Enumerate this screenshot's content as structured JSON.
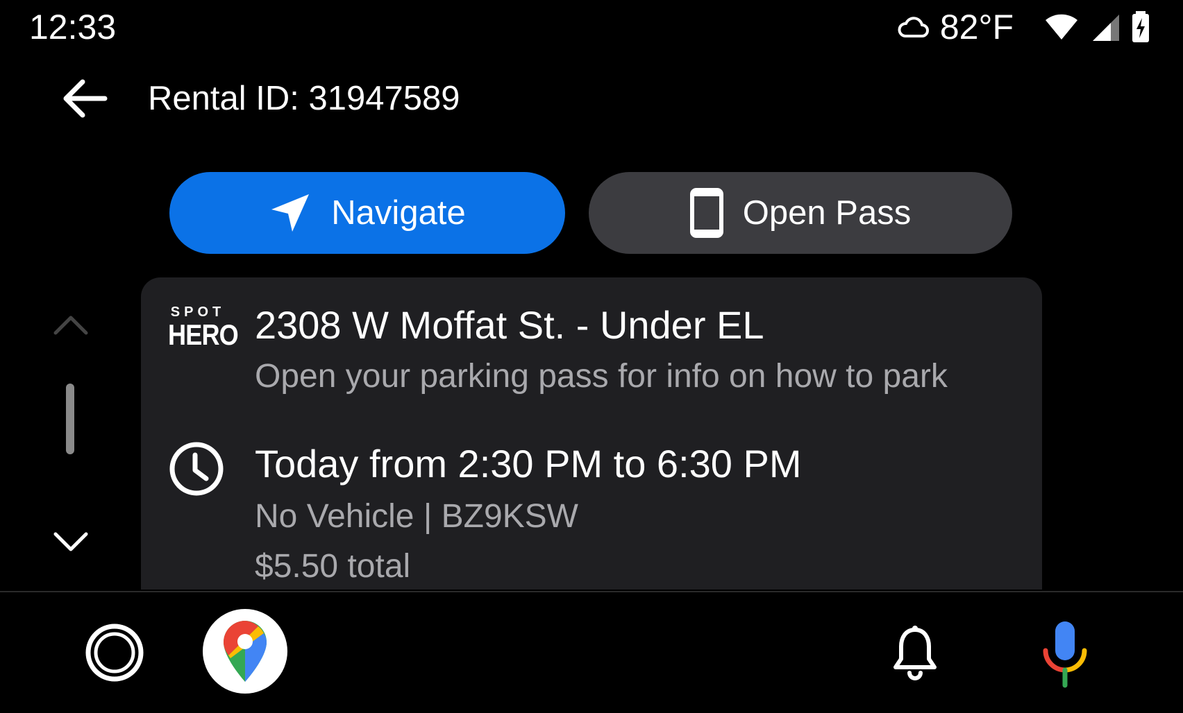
{
  "status_bar": {
    "time": "12:33",
    "temperature": "82°F",
    "weather_icon": "cloud-icon",
    "wifi_icon": "wifi-icon",
    "signal_icon": "cell-signal-icon",
    "battery_icon": "battery-charging-icon"
  },
  "header": {
    "back_icon": "arrow-left-icon",
    "title": "Rental ID: 31947589"
  },
  "actions": {
    "navigate_label": "Navigate",
    "navigate_icon": "navigation-arrow-icon",
    "open_pass_label": "Open Pass",
    "open_pass_icon": "phone-icon"
  },
  "card": {
    "logo_top": "SPOT",
    "logo_bottom": "HERO",
    "address": "2308 W Moffat St. - Under EL",
    "address_sub": "Open your parking pass for info on how to park",
    "time_range": "Today from 2:30 PM to 6:30 PM",
    "vehicle": "No Vehicle | BZ9KSW",
    "total": "$5.50 total"
  },
  "bottom_bar": {
    "home_icon": "home-circle-icon",
    "maps_icon": "google-maps-icon",
    "notifications_icon": "bell-icon",
    "assistant_icon": "microphone-icon"
  },
  "colors": {
    "navigate_button": "#0b72e7",
    "open_pass_button": "#3c3c40",
    "card_background": "#1f1f22",
    "secondary_text": "#a9a9ad"
  }
}
